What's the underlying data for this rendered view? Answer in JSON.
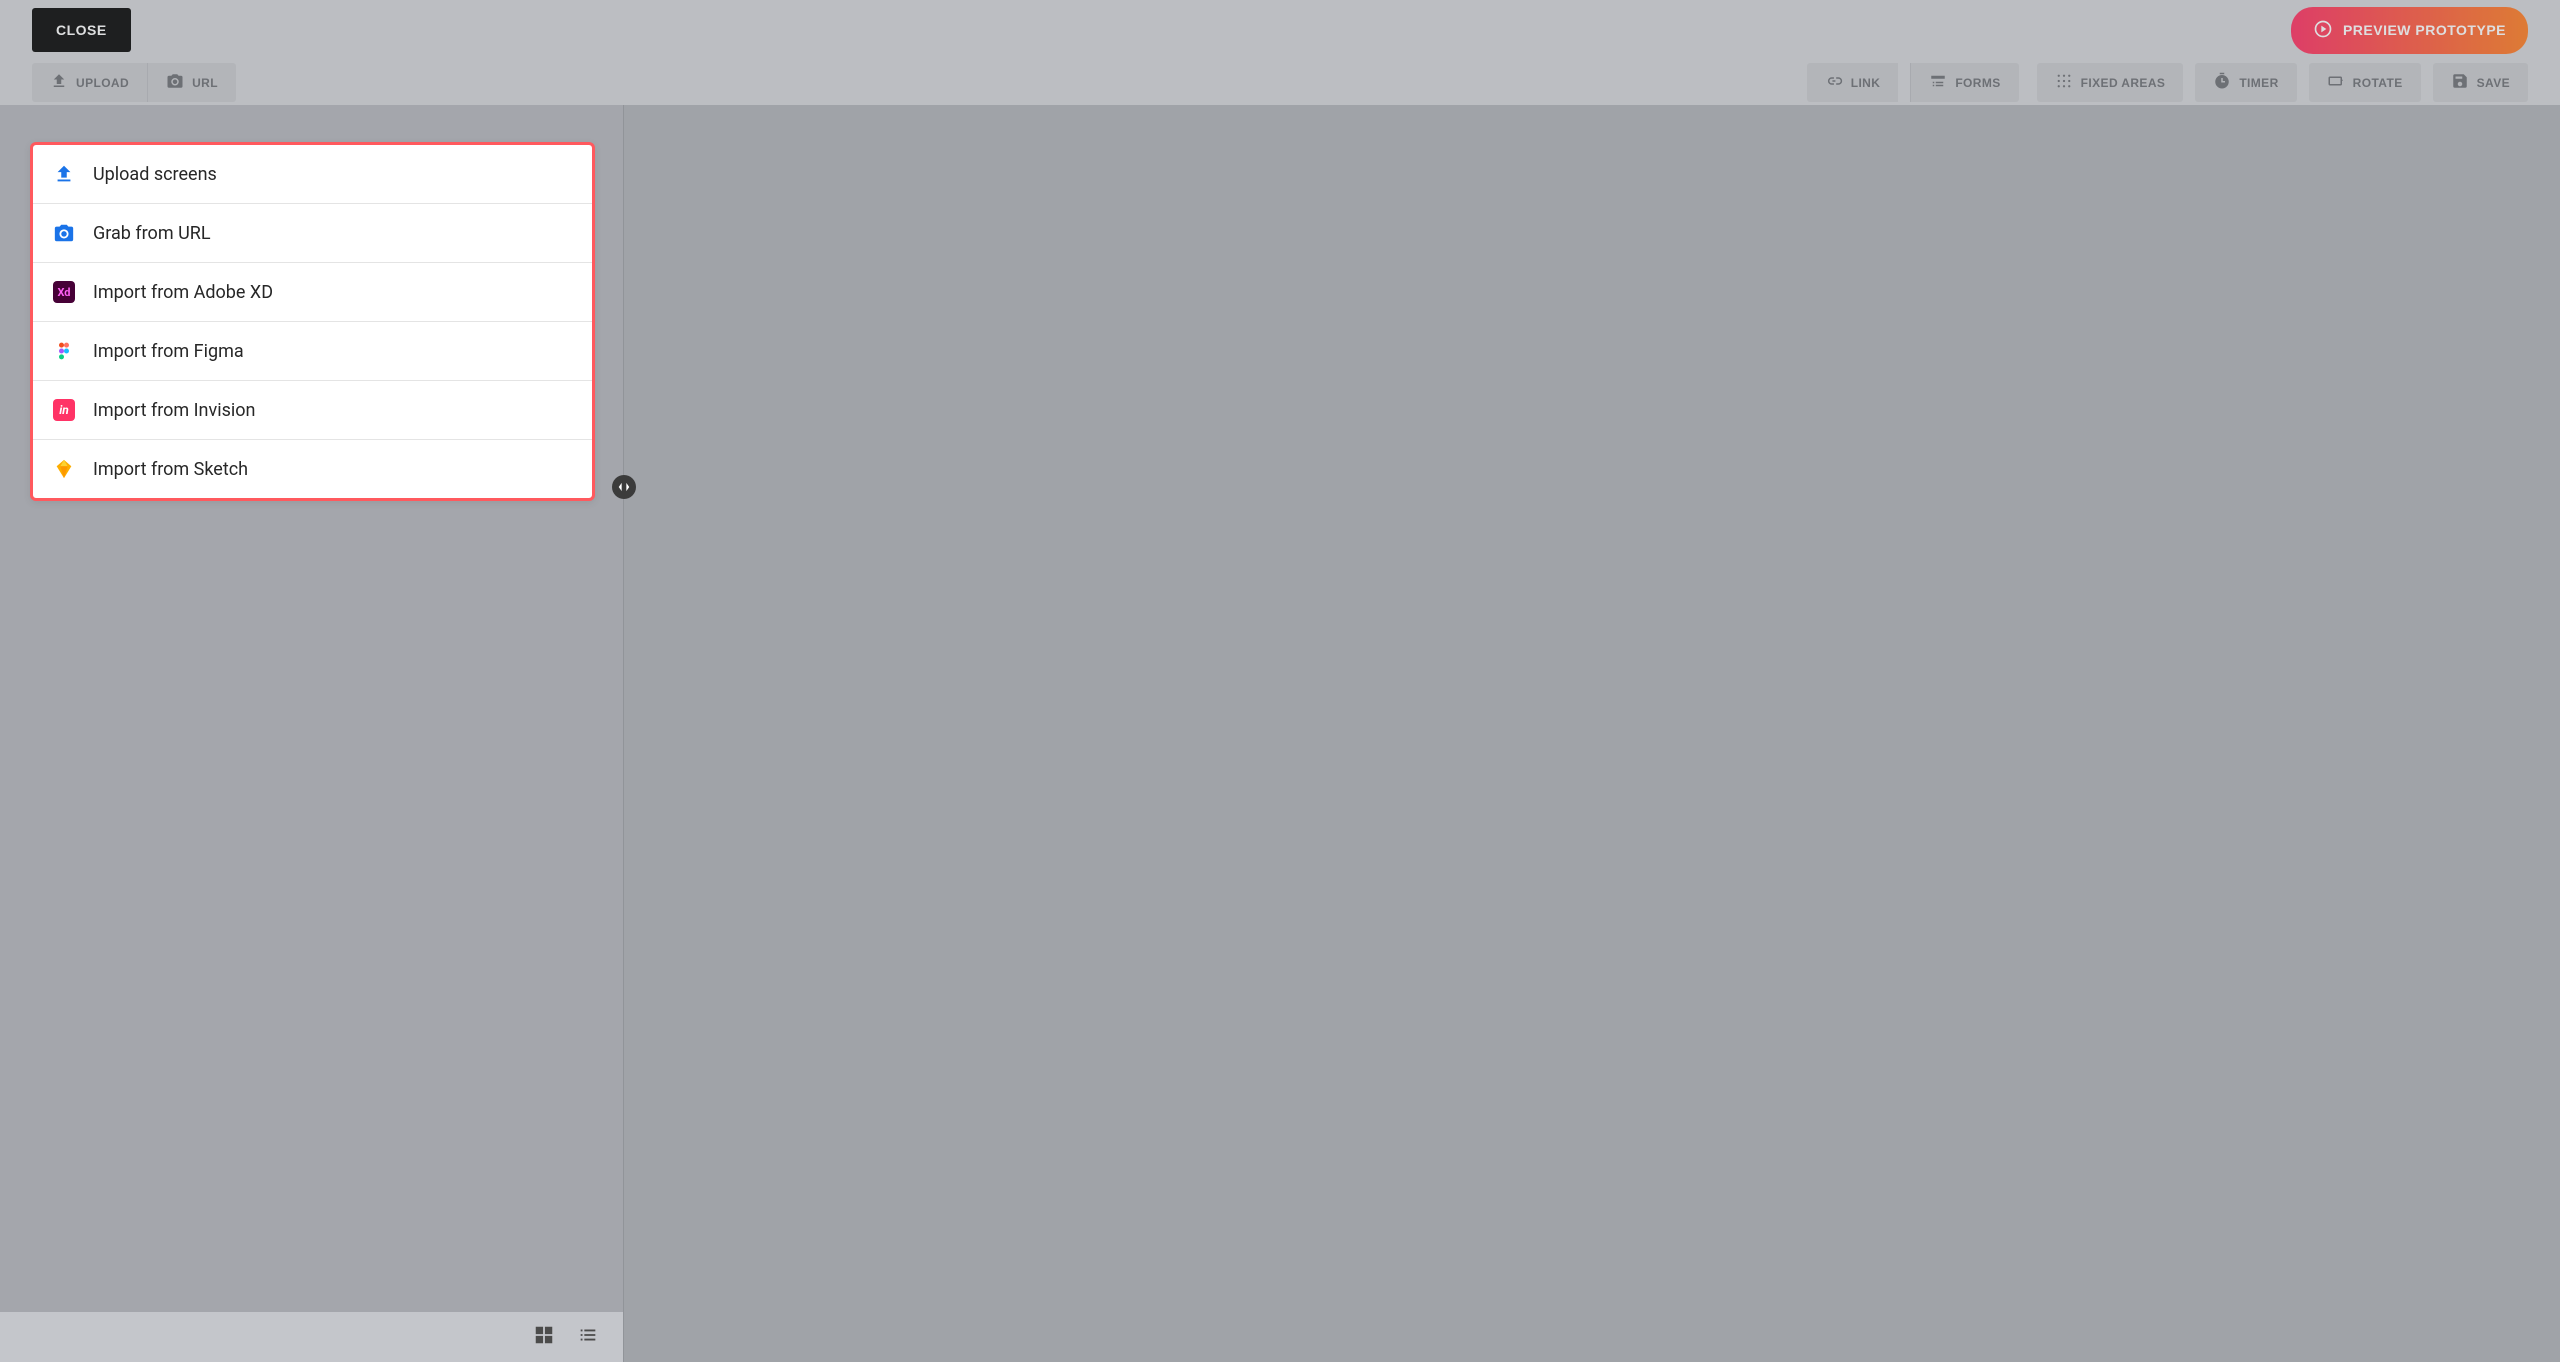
{
  "topbar": {
    "close_label": "CLOSE",
    "preview_label": "PREVIEW PROTOTYPE"
  },
  "toolbar": {
    "upload_label": "UPLOAD",
    "url_label": "URL",
    "link_label": "LINK",
    "forms_label": "FORMS",
    "fixed_areas_label": "FIXED AREAS",
    "timer_label": "TIMER",
    "rotate_label": "ROTATE",
    "save_label": "SAVE"
  },
  "import_menu": {
    "items": [
      {
        "label": "Upload screens",
        "icon": "upload"
      },
      {
        "label": "Grab from URL",
        "icon": "camera"
      },
      {
        "label": "Import from Adobe XD",
        "icon": "xd"
      },
      {
        "label": "Import from Figma",
        "icon": "figma"
      },
      {
        "label": "Import from Invision",
        "icon": "invision"
      },
      {
        "label": "Import from Sketch",
        "icon": "sketch"
      }
    ]
  },
  "xd_text": "Xd",
  "in_text": "in"
}
